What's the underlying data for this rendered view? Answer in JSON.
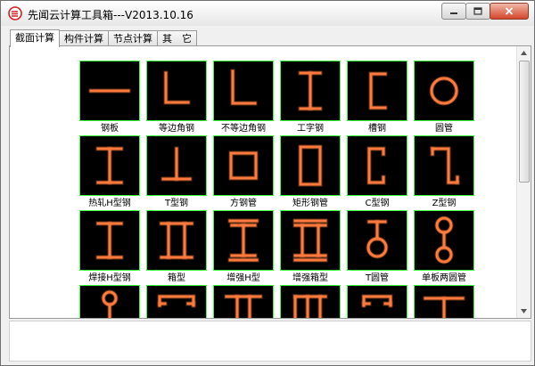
{
  "window": {
    "title": "先闻云计算工具箱---V2013.10.16"
  },
  "icons": {
    "app": "app-logo-icon",
    "minimize": "minimize-icon",
    "maximize": "maximize-icon",
    "close": "close-icon"
  },
  "tabs": [
    {
      "label": "截面计算",
      "active": true
    },
    {
      "label": "构件计算",
      "active": false
    },
    {
      "label": "节点计算",
      "active": false
    },
    {
      "label": "其　它",
      "active": false
    }
  ],
  "colors": {
    "section_stroke": "#ff7a3c",
    "thumb_border": "#3cff3c",
    "thumb_bg": "#000000"
  },
  "sections": [
    {
      "label": "钢板",
      "icon": "plate-section-icon"
    },
    {
      "label": "等边角钢",
      "icon": "equal-angle-section-icon"
    },
    {
      "label": "不等边角钢",
      "icon": "unequal-angle-section-icon"
    },
    {
      "label": "工字钢",
      "icon": "i-beam-section-icon"
    },
    {
      "label": "槽钢",
      "icon": "channel-section-icon"
    },
    {
      "label": "圆管",
      "icon": "round-tube-section-icon"
    },
    {
      "label": "热轧H型钢",
      "icon": "hot-rolled-h-section-icon"
    },
    {
      "label": "T型钢",
      "icon": "t-section-icon"
    },
    {
      "label": "方钢管",
      "icon": "square-tube-section-icon"
    },
    {
      "label": "矩形钢管",
      "icon": "rect-tube-section-icon"
    },
    {
      "label": "C型钢",
      "icon": "c-section-icon"
    },
    {
      "label": "Z型钢",
      "icon": "z-section-icon"
    },
    {
      "label": "焊接H型钢",
      "icon": "welded-h-section-icon"
    },
    {
      "label": "箱型",
      "icon": "box-section-icon"
    },
    {
      "label": "增强H型",
      "icon": "reinforced-h-section-icon"
    },
    {
      "label": "增强箱型",
      "icon": "reinforced-box-section-icon"
    },
    {
      "label": "T圆管",
      "icon": "t-round-tube-section-icon"
    },
    {
      "label": "单板两圆管",
      "icon": "plate-two-tubes-section-icon"
    },
    {
      "label": "",
      "icon": "tube-plate-tube-section-icon"
    },
    {
      "label": "",
      "icon": "double-channel-section-icon"
    },
    {
      "label": "",
      "icon": "double-t-section-icon"
    },
    {
      "label": "",
      "icon": "t-channel-section-icon"
    },
    {
      "label": "",
      "icon": "double-channel-alt-section-icon"
    },
    {
      "label": "",
      "icon": "wide-t-section-icon"
    }
  ]
}
